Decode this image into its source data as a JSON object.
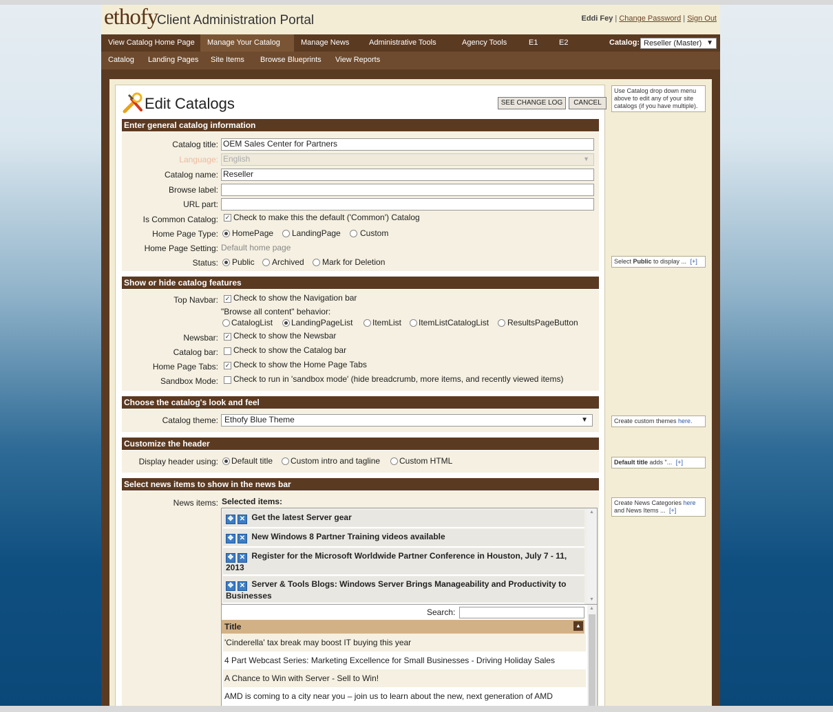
{
  "header": {
    "logo_text": "ethofy",
    "portal_title": "Client Administration Portal",
    "user_name": "Eddi Fey",
    "change_password": "Change Password",
    "sign_out": "Sign Out",
    "separator": "|"
  },
  "nav1": {
    "items": [
      "View Catalog Home Page",
      "Manage Your Catalog",
      "Manage News",
      "Administrative Tools",
      "Agency Tools",
      "E1",
      "E2"
    ],
    "active": "Manage Your Catalog",
    "catalog_label": "Catalog:",
    "catalog_value": "Reseller (Master)"
  },
  "nav2": {
    "items": [
      "Catalog",
      "Landing Pages",
      "Site Items",
      "Browse Blueprints",
      "View Reports"
    ]
  },
  "page": {
    "title": "Edit Catalogs",
    "see_change_log": "SEE CHANGE LOG",
    "cancel": "CANCEL"
  },
  "sections": {
    "general": "Enter general catalog information",
    "features": "Show or hide catalog features",
    "look": "Choose the catalog's look and feel",
    "header": "Customize the header",
    "news": "Select news items to show in the news bar"
  },
  "general": {
    "catalog_title_label": "Catalog title:",
    "catalog_title_value": "OEM Sales Center for Partners",
    "language_label": "Language:",
    "language_value": "English",
    "catalog_name_label": "Catalog name:",
    "catalog_name_value": "Reseller",
    "browse_label_label": "Browse label:",
    "browse_label_value": "",
    "url_part_label": "URL part:",
    "url_part_value": "",
    "is_common_label": "Is Common Catalog:",
    "is_common_text": "Check to make this the default ('Common') Catalog",
    "home_page_type_label": "Home Page Type:",
    "home_page_type_options": [
      "HomePage",
      "LandingPage",
      "Custom"
    ],
    "home_page_type_selected": "HomePage",
    "home_page_setting_label": "Home Page Setting:",
    "home_page_setting_value": "Default home page",
    "status_label": "Status:",
    "status_options": [
      "Public",
      "Archived",
      "Mark for Deletion"
    ],
    "status_selected": "Public"
  },
  "features": {
    "top_navbar_label": "Top Navbar:",
    "top_navbar_text": "Check to show the Navigation bar",
    "browse_all_label": "\"Browse all content\" behavior:",
    "browse_options": [
      "CatalogList",
      "LandingPageList",
      "ItemList",
      "ItemListCatalogList",
      "ResultsPageButton"
    ],
    "browse_selected": "LandingPageList",
    "newsbar_label": "Newsbar:",
    "newsbar_text": "Check to show the Newsbar",
    "catalog_bar_label": "Catalog bar:",
    "catalog_bar_text": "Check to show the Catalog bar",
    "home_tabs_label": "Home Page Tabs:",
    "home_tabs_text": "Check to show the Home Page Tabs",
    "sandbox_label": "Sandbox Mode:",
    "sandbox_text": "Check to run in 'sandbox mode' (hide breadcrumb, more items, and recently viewed items)"
  },
  "look": {
    "theme_label": "Catalog theme:",
    "theme_value": "Ethofy Blue Theme"
  },
  "header_custom": {
    "display_label": "Display header using:",
    "options": [
      "Default title",
      "Custom intro and tagline",
      "Custom HTML"
    ],
    "selected": "Default title"
  },
  "news": {
    "label": "News items:",
    "selected_label": "Selected items:",
    "selected_items": [
      "Get the latest Server gear",
      "New Windows 8 Partner Training videos available",
      "Register for the Microsoft Worldwide Partner Conference in Houston, July 7 - 11, 2013",
      "Server & Tools Blogs: Windows Server Brings Manageability and Productivity to Businesses"
    ],
    "search_label": "Search:",
    "column_title": "Title",
    "available_items": [
      "'Cinderella' tax break may boost IT buying this year",
      "4 Part Webcast Series: Marketing Excellence for Small Businesses - Driving Holiday Sales",
      "A Chance to Win with Server - Sell to Win!",
      "AMD is coming to a city near you – join us to learn about the new, next generation of AMD"
    ]
  },
  "tips": {
    "catalog_tip": "Use Catalog drop down menu above to edit any of your site catalogs (if you have multiple).",
    "status_tip_pre": "Select ",
    "status_tip_bold": "Public",
    "status_tip_post": " to display ...",
    "more": "[+]",
    "theme_tip_pre": "Create custom themes ",
    "theme_tip_link": "here.",
    "header_tip_bold": "Default title",
    "header_tip_post": " adds \"...",
    "news_tip_pre": "Create News Categories ",
    "news_tip_link": "here",
    "news_tip_post": " and News Items ..."
  }
}
